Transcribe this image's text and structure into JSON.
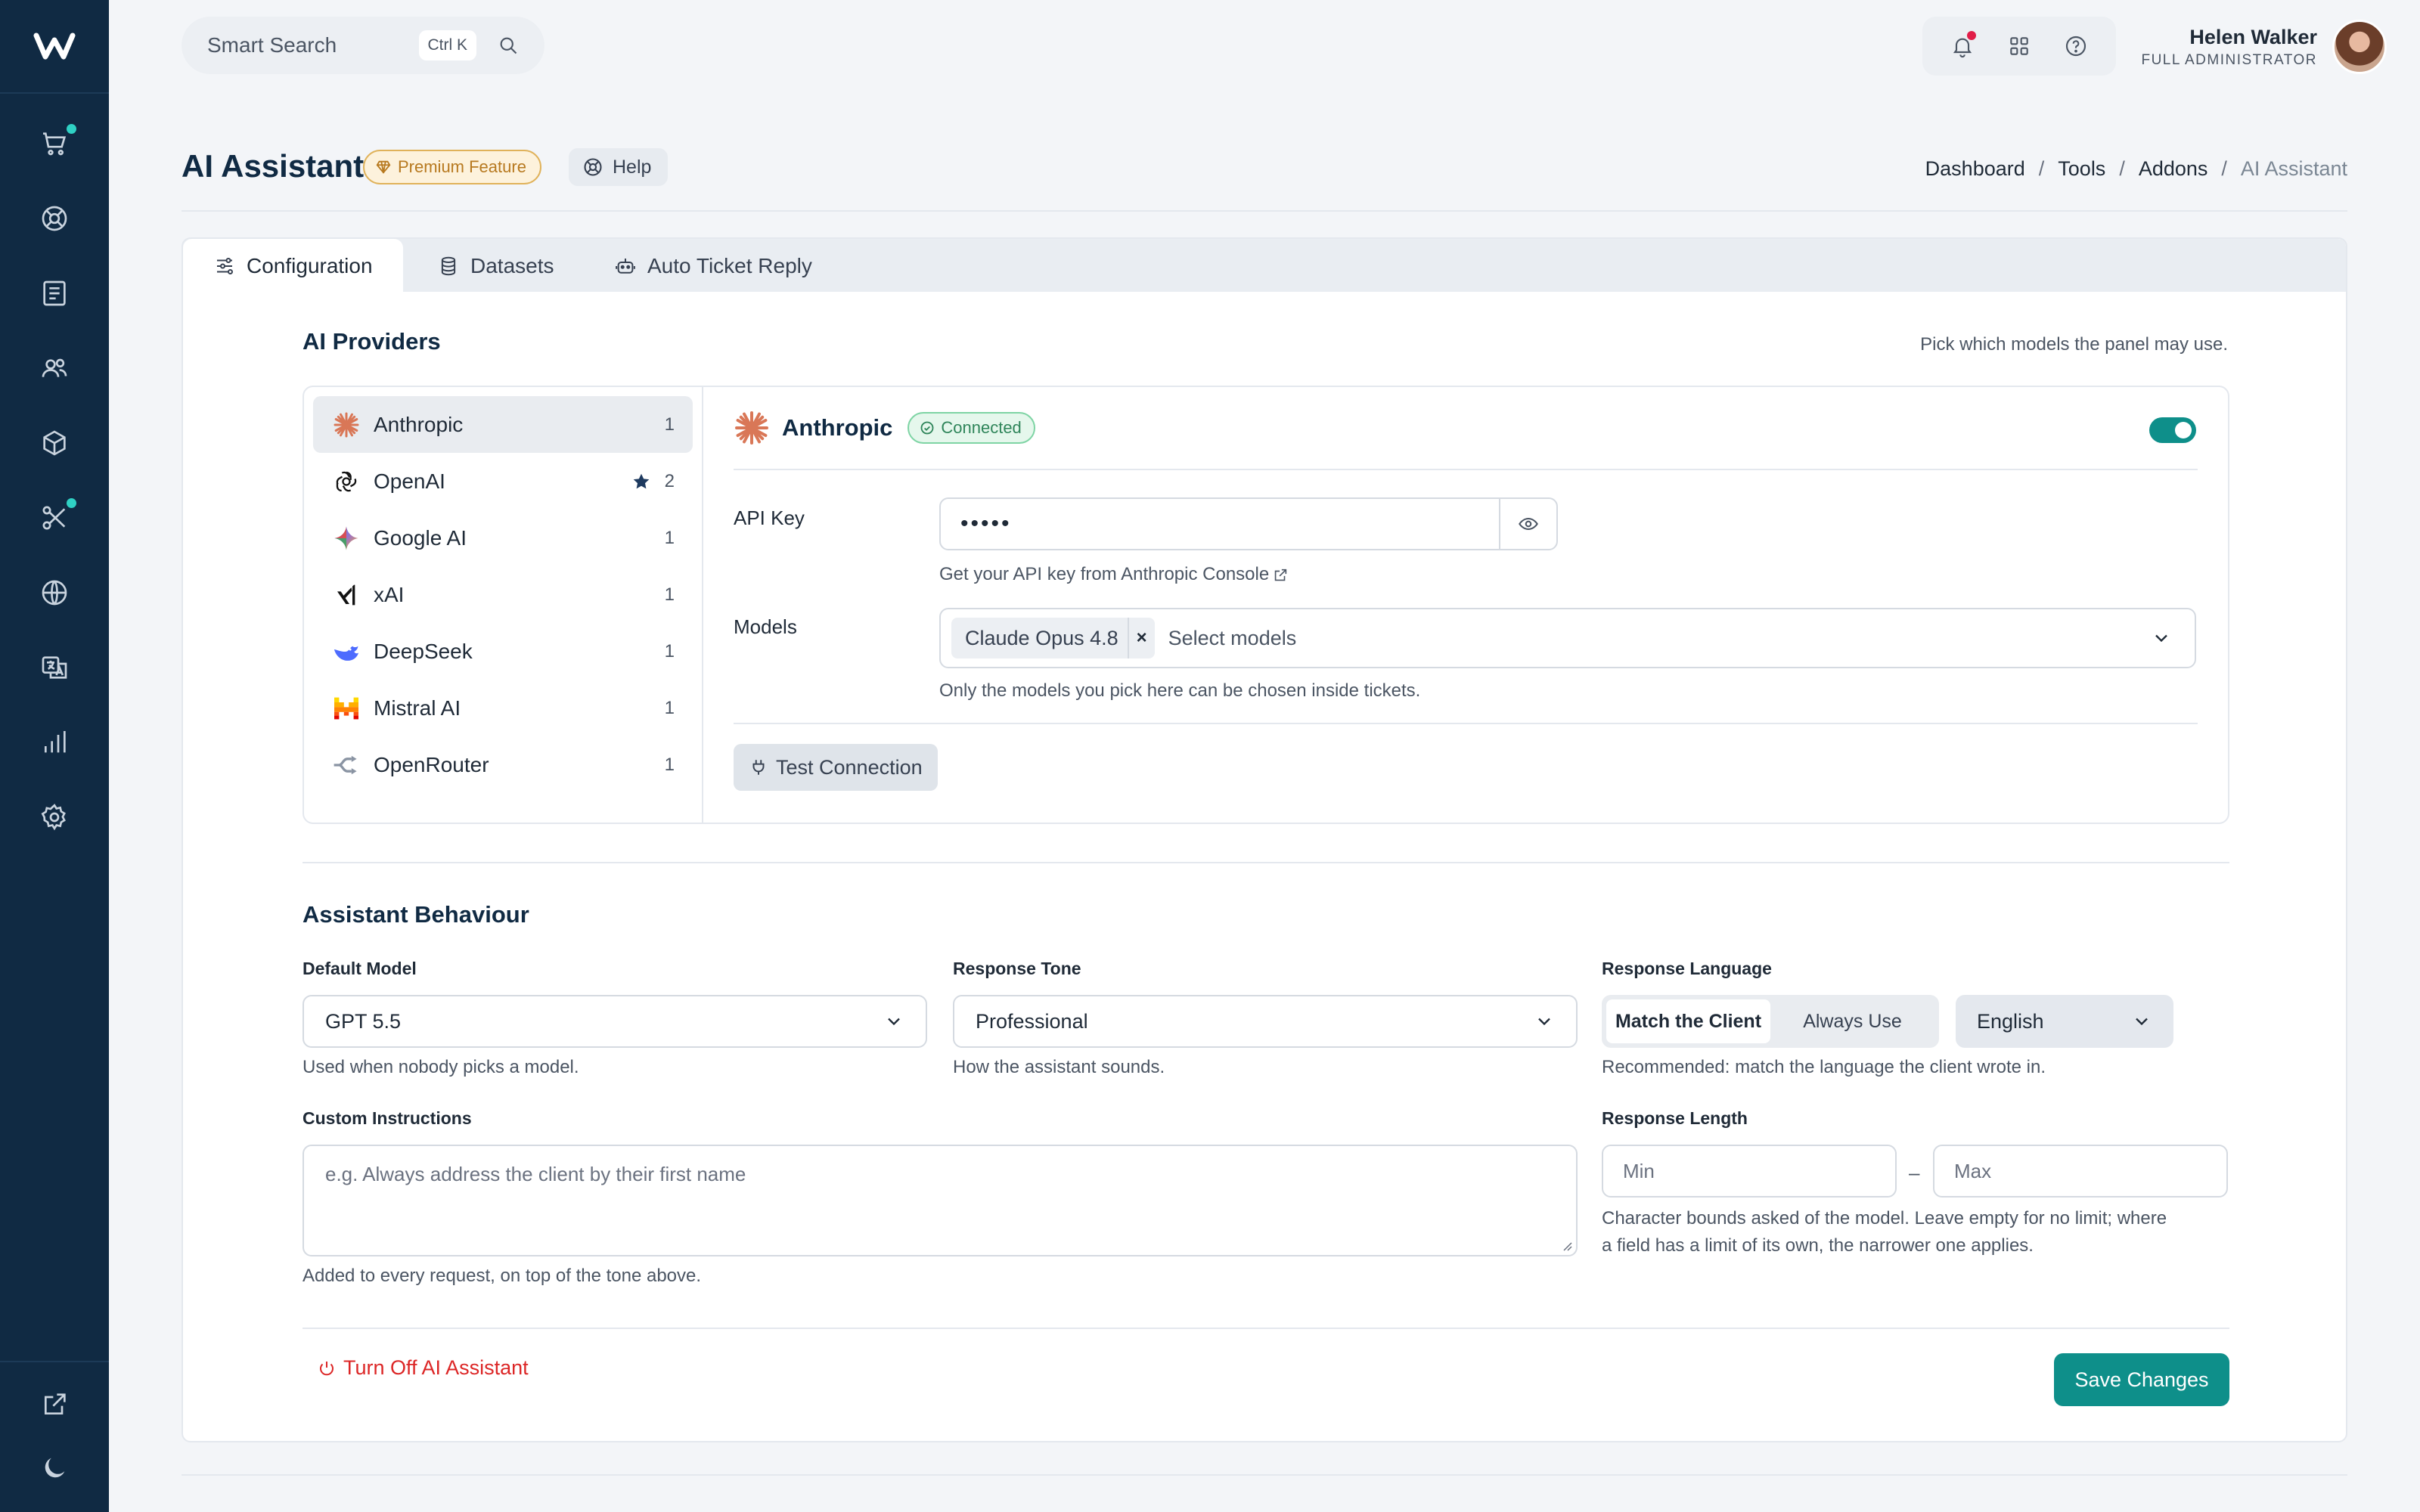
{
  "search": {
    "label": "Smart Search",
    "shortcut": "Ctrl K"
  },
  "user": {
    "name": "Helen Walker",
    "role": "FULL ADMINISTRATOR"
  },
  "page": {
    "title": "AI Assistant",
    "badge": "Premium Feature",
    "help": "Help"
  },
  "breadcrumb": [
    "Dashboard",
    "Tools",
    "Addons",
    "AI Assistant"
  ],
  "tabs": [
    "Configuration",
    "Datasets",
    "Auto Ticket Reply"
  ],
  "providers_section": {
    "title": "AI Providers",
    "hint": "Pick which models the panel may use."
  },
  "providers": [
    {
      "name": "Anthropic",
      "count": "1",
      "icon": "anthropic-icon"
    },
    {
      "name": "OpenAI",
      "count": "2",
      "icon": "openai-icon",
      "starred": true
    },
    {
      "name": "Google AI",
      "count": "1",
      "icon": "google-ai-icon"
    },
    {
      "name": "xAI",
      "count": "1",
      "icon": "xai-icon"
    },
    {
      "name": "DeepSeek",
      "count": "1",
      "icon": "deepseek-icon"
    },
    {
      "name": "Mistral AI",
      "count": "1",
      "icon": "mistral-icon"
    },
    {
      "name": "OpenRouter",
      "count": "1",
      "icon": "openrouter-icon"
    }
  ],
  "provider_detail": {
    "name": "Anthropic",
    "status": "Connected",
    "enabled": true,
    "api_key_label": "API Key",
    "api_key_value": "•••••",
    "api_key_help": "Get your API key from Anthropic Console",
    "models_label": "Models",
    "selected_model": "Claude Opus 4.8",
    "models_placeholder": "Select models",
    "models_help": "Only the models you pick here can be chosen inside tickets.",
    "test_button": "Test Connection"
  },
  "behaviour": {
    "title": "Assistant Behaviour",
    "default_model": {
      "label": "Default Model",
      "value": "GPT 5.5",
      "help": "Used when nobody picks a model."
    },
    "tone": {
      "label": "Response Tone",
      "value": "Professional",
      "help": "How the assistant sounds."
    },
    "language": {
      "label": "Response Language",
      "options": [
        "Match the Client",
        "Always Use"
      ],
      "selected_option": "Match the Client",
      "value": "English",
      "help": "Recommended: match the language the client wrote in."
    },
    "instructions": {
      "label": "Custom Instructions",
      "placeholder": "e.g. Always address the client by their first name",
      "help": "Added to every request, on top of the tone above."
    },
    "length": {
      "label": "Response Length",
      "min_placeholder": "Min",
      "max_placeholder": "Max",
      "separator": "–",
      "help_line1": "Character bounds asked of the model. Leave empty for no limit; where",
      "help_line2": "a field has a limit of its own, the narrower one applies."
    }
  },
  "actions": {
    "turn_off": "Turn Off AI Assistant",
    "save": "Save Changes"
  },
  "colors": {
    "sidebar": "#102a43",
    "accent": "#0e8f8a",
    "danger": "#dc2626",
    "success": "#2f855a"
  }
}
